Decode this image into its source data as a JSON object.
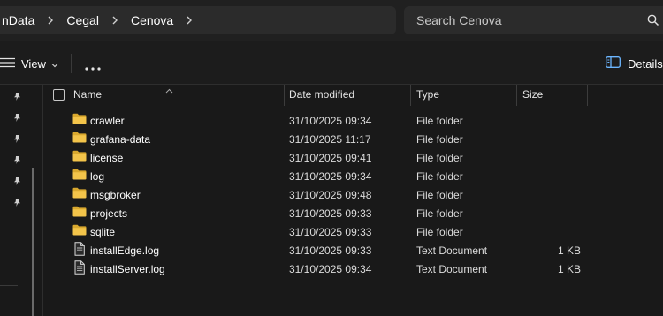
{
  "breadcrumb": {
    "items": [
      "nData",
      "Cegal",
      "Cenova"
    ]
  },
  "search": {
    "placeholder": "Search Cenova"
  },
  "toolbar": {
    "view_label": "View",
    "details_label": "Details"
  },
  "columns": {
    "name": "Name",
    "date_modified": "Date modified",
    "type": "Type",
    "size": "Size"
  },
  "files": [
    {
      "name": "crawler",
      "date": "31/10/2025 09:34",
      "type": "File folder",
      "size": "",
      "icon": "folder-icon"
    },
    {
      "name": "grafana-data",
      "date": "31/10/2025 11:17",
      "type": "File folder",
      "size": "",
      "icon": "folder-icon"
    },
    {
      "name": "license",
      "date": "31/10/2025 09:41",
      "type": "File folder",
      "size": "",
      "icon": "folder-icon"
    },
    {
      "name": "log",
      "date": "31/10/2025 09:34",
      "type": "File folder",
      "size": "",
      "icon": "folder-icon"
    },
    {
      "name": "msgbroker",
      "date": "31/10/2025 09:48",
      "type": "File folder",
      "size": "",
      "icon": "folder-icon"
    },
    {
      "name": "projects",
      "date": "31/10/2025 09:33",
      "type": "File folder",
      "size": "",
      "icon": "folder-icon"
    },
    {
      "name": "sqlite",
      "date": "31/10/2025 09:33",
      "type": "File folder",
      "size": "",
      "icon": "folder-icon"
    },
    {
      "name": "installEdge.log",
      "date": "31/10/2025 09:33",
      "type": "Text Document",
      "size": "1 KB",
      "icon": "text-document-icon"
    },
    {
      "name": "installServer.log",
      "date": "31/10/2025 09:34",
      "type": "Text Document",
      "size": "1 KB",
      "icon": "text-document-icon"
    }
  ],
  "colors": {
    "background": "#191919",
    "folder": "#f3c44a",
    "folder_dark": "#d9a82e"
  }
}
